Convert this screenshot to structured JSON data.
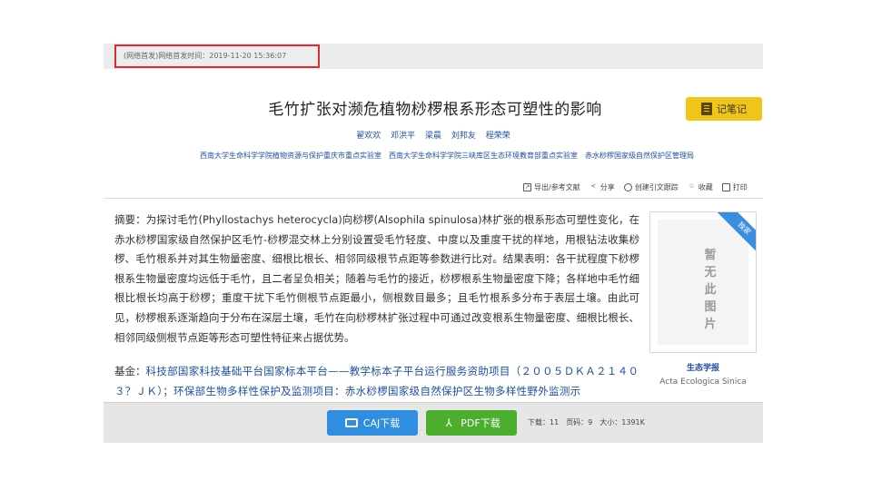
{
  "publish_info": "(网络首发)网络首发时间：2019-11-20 15:36:07",
  "title": "毛竹扩张对濒危植物桫椤根系形态可塑性的影响",
  "note_button": "记笔记",
  "authors": [
    "翟欢欢",
    "邓洪平",
    "梁晨",
    "刘邦友",
    "程荣荣"
  ],
  "affiliations": "西南大学生命科学学院植物资源与保护重庆市重点实验室　西南大学生命科学学院三峡库区生态环境教育部重点实验室　赤水桫椤国家级自然保护区管理局",
  "toolbar": {
    "export": "导出/参考文献",
    "share": "分享",
    "cite": "创建引文跟踪",
    "favorite": "收藏",
    "print": "打印"
  },
  "abstract": {
    "label": "摘要：",
    "text": "为探讨毛竹(Phyllostachys heterocycla)向桫椤(Alsophila spinulosa)林扩张的根系形态可塑性变化，在赤水桫椤国家级自然保护区毛竹-桫椤混交林上分别设置受毛竹轻度、中度以及重度干扰的样地，用根钻法收集桫椤、毛竹根系并对其生物量密度、细根比根长、相邻同级根节点距等参数进行比对。结果表明：各干扰程度下桫椤根系生物量密度均远低于毛竹，且二者呈负相关；随着与毛竹的接近，桫椤根系生物量密度下降；各样地中毛竹细根比根长均高于桫椤；重度干扰下毛竹侧根节点距最小，侧根数目最多；且毛竹根系多分布于表层土壤。由此可见，桫椤根系逐渐趋向于分布在深层土壤，毛竹在向桫椤林扩张过程中可通过改变根系生物量密度、细根比根长、相邻同级侧根节点距等形态可塑性特征来占据优势。"
  },
  "fund": {
    "label": "基金：",
    "text": "科技部国家科技基础平台国家标本平台——教学标本子平台运行服务资助项目（２００５ＤＫＡ２１４０３？ＪＫ）；环保部生物多样性保护及监测项目：赤水桫椤国家级自然保护区生物多样性野外监测示"
  },
  "cover": {
    "ribbon": "独家",
    "placeholder": "暂无此图片"
  },
  "journal": {
    "name_cn": "生态学报",
    "name_en": "Acta Ecologica Sinica"
  },
  "download": {
    "caj_label": "CAJ下载",
    "pdf_label": "PDF下载",
    "stats": "下载：11　页码：9　大小：1391K"
  },
  "colors": {
    "link": "#1d4fa3",
    "note_button": "#f0c419",
    "caj_button": "#2f8ee0",
    "pdf_button": "#4cae2d",
    "highlight_box": "#e8262b"
  }
}
